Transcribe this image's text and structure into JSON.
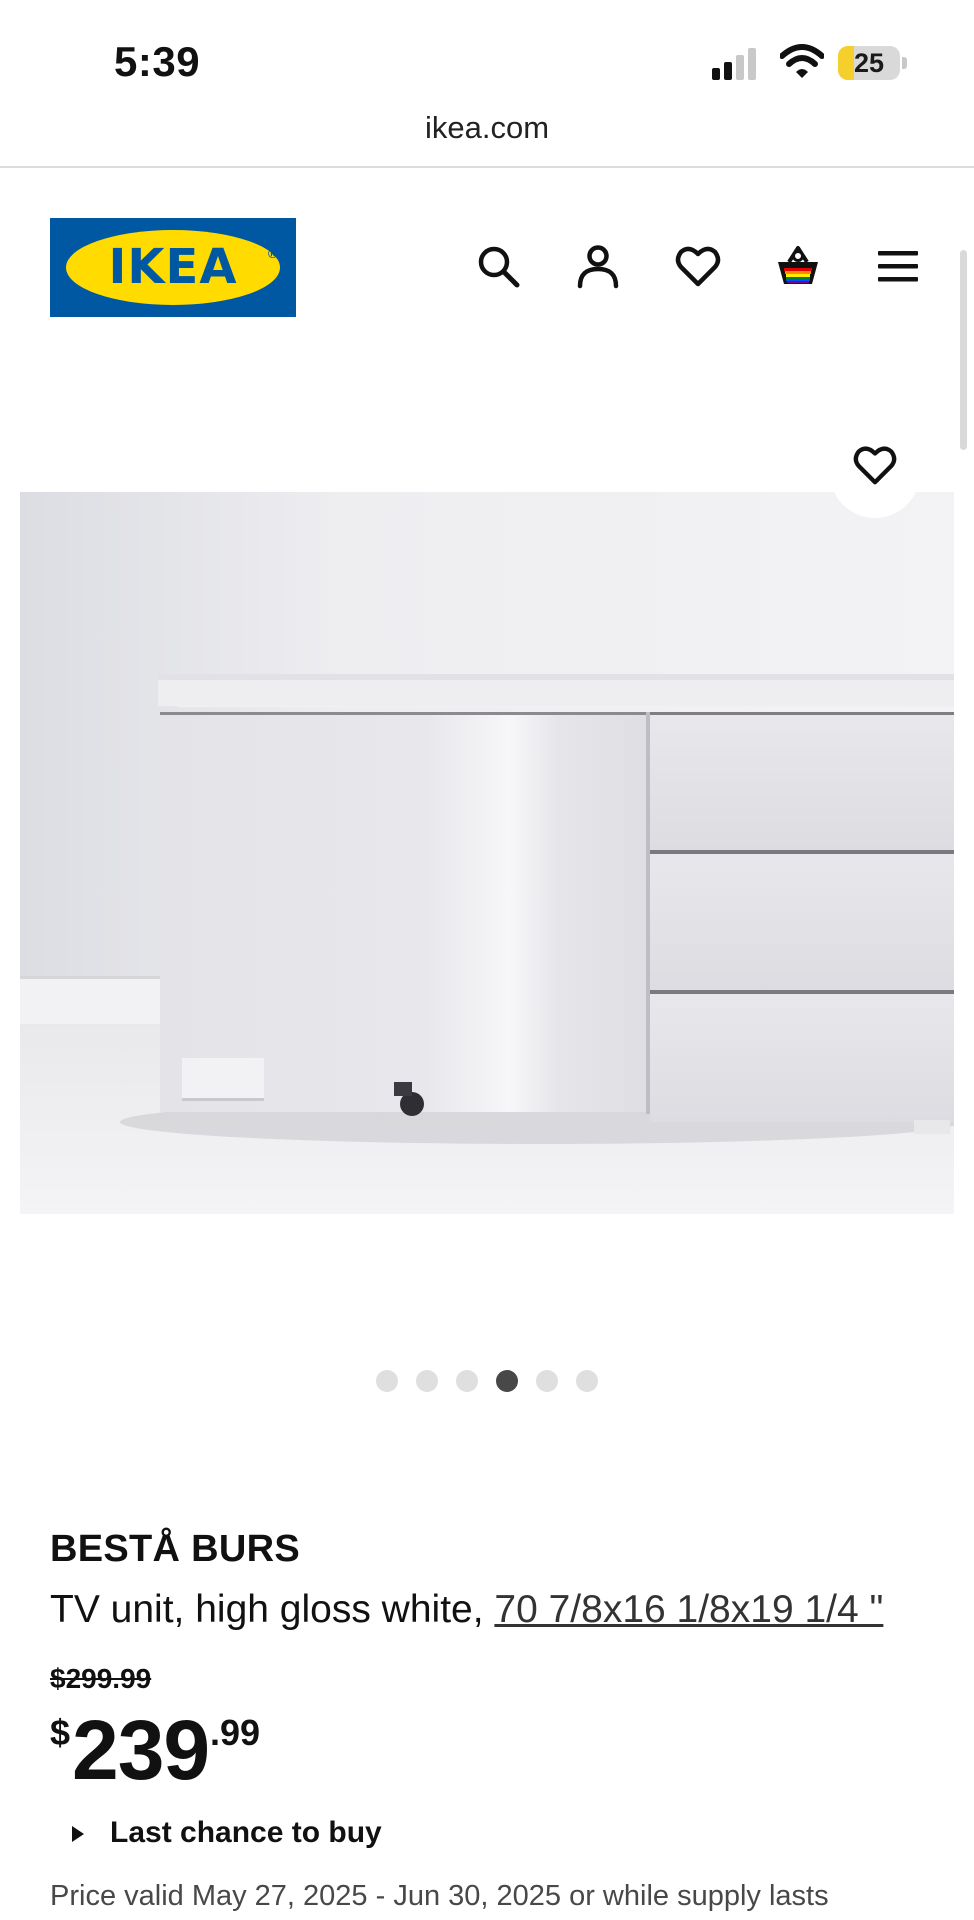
{
  "status_bar": {
    "time": "5:39",
    "battery_percent": "25",
    "signal_bars_active": 2,
    "signal_bars_total": 4
  },
  "browser": {
    "url": "ikea.com"
  },
  "header": {
    "logo_text": "IKEA",
    "icons": [
      "search-icon",
      "account-icon",
      "heart-icon",
      "cart-icon",
      "menu-icon"
    ]
  },
  "gallery": {
    "image_count": 6,
    "active_index": 3
  },
  "product": {
    "name": "BESTÅ BURS",
    "description": "TV unit, high gloss white, ",
    "dimensions": "70 7/8x16 1/8x19 1/4 \"",
    "old_price": "$299.99",
    "price_currency": "$",
    "price_integer": "239",
    "price_decimal": ".99",
    "last_chance_label": "Last chance to buy",
    "price_valid_text": "Price valid May 27, 2025 - Jun 30, 2025 or while supply lasts"
  },
  "colors": {
    "ikea_blue": "#0058a3",
    "ikea_yellow": "#ffdb00",
    "battery_yellow": "#f5cf2b",
    "text_dark": "#111111"
  }
}
